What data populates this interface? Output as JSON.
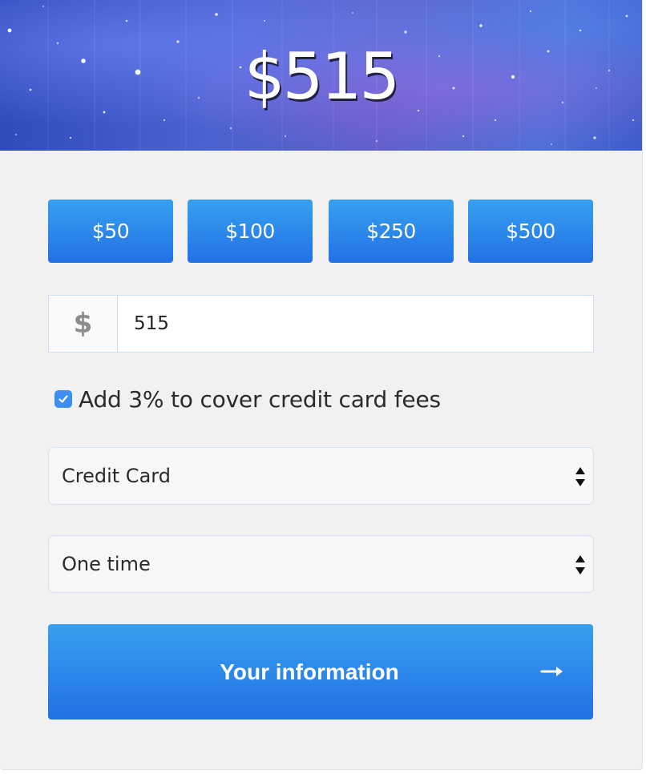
{
  "hero": {
    "amount_display": "$515"
  },
  "presets": [
    {
      "label": "$50"
    },
    {
      "label": "$100"
    },
    {
      "label": "$250"
    },
    {
      "label": "$500"
    }
  ],
  "amount": {
    "currency_symbol": "$",
    "value": "515"
  },
  "fee": {
    "checked": true,
    "label": "Add 3% to cover credit card fees"
  },
  "payment_method": {
    "selected": "Credit Card"
  },
  "frequency": {
    "selected": "One time"
  },
  "submit": {
    "label": "Your information",
    "icon": "arrow-right-icon"
  },
  "colors": {
    "accent_top": "#37a0ef",
    "accent_bottom": "#2371e6",
    "background": "#f1f1f1"
  }
}
